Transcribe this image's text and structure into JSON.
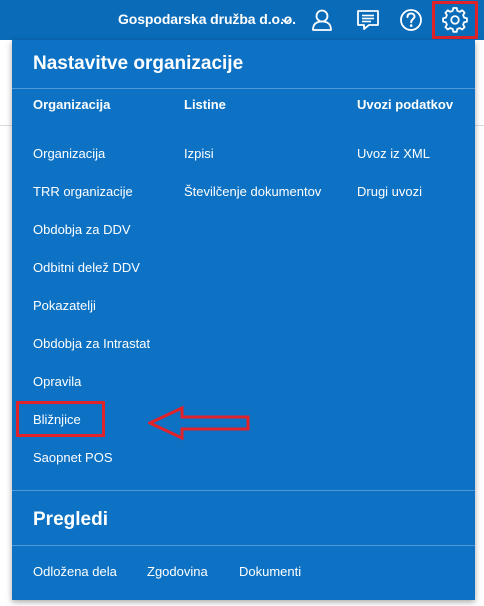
{
  "header": {
    "company_name": "Gospodarska družba d.o.o.",
    "icons": [
      "chevron-down-icon",
      "user-icon",
      "messages-icon",
      "help-icon",
      "gear-icon"
    ],
    "brand_color": "#0a6bb8"
  },
  "panel": {
    "title": "Nastavitve organizacije",
    "background_color": "#0d72c4",
    "columns": [
      {
        "heading": "Organizacija",
        "items": [
          "Organizacija",
          "TRR organizacije",
          "Obdobja za DDV",
          "Odbitni delež DDV",
          "Pokazatelji",
          "Obdobja za Intrastat",
          "Opravila",
          "Bližnjice",
          "Saopnet POS"
        ]
      },
      {
        "heading": "Listine",
        "items": [
          "Izpisi",
          "Številčenje dokumentov"
        ]
      },
      {
        "heading": "Uvozi podatkov",
        "items": [
          "Uvoz iz XML",
          "Drugi uvozi"
        ]
      }
    ]
  },
  "pregledi": {
    "title": "Pregledi",
    "items": [
      "Odložena dela",
      "Zgodovina",
      "Dokumenti"
    ]
  },
  "annotation": {
    "highlight_color": "#e0222b",
    "highlighted_items": [
      "gear-icon",
      "Bližnjice"
    ]
  }
}
